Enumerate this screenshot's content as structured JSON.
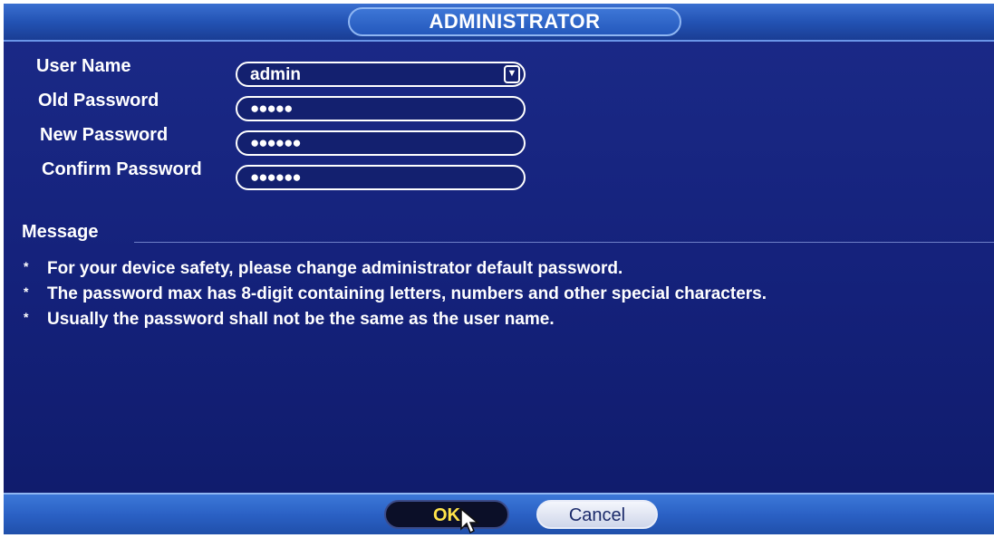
{
  "dialog": {
    "title": "ADMINISTRATOR"
  },
  "form": {
    "username_label": "User Name",
    "username_value": "admin",
    "old_password_label": "Old Password",
    "old_password_mask": "●●●●●",
    "new_password_label": "New Password",
    "new_password_mask": "●●●●●●",
    "confirm_password_label": "Confirm Password",
    "confirm_password_mask": "●●●●●●"
  },
  "message": {
    "title": "Message",
    "lines": [
      "For your device safety, please change administrator default password.",
      "The password max has 8-digit containing letters, numbers and other special characters.",
      "Usually the password shall not be the same as the user name."
    ]
  },
  "buttons": {
    "ok_label": "OK",
    "cancel_label": "Cancel"
  },
  "icons": {
    "dropdown": "chevron-down-icon",
    "cursor": "mouse-pointer-icon"
  },
  "colors": {
    "background": "#14217a",
    "title_bar": "#2353b4",
    "ok_text": "#ffe34a"
  }
}
